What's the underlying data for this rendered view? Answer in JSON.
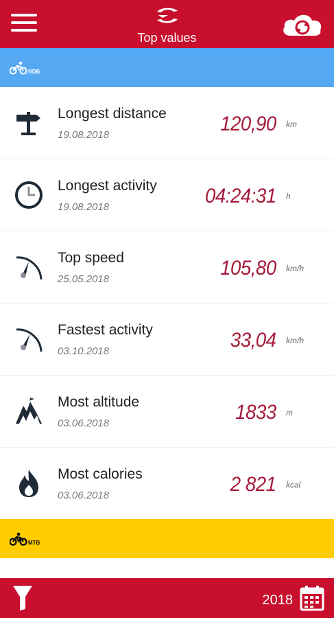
{
  "header": {
    "title": "Top values",
    "menu_icon": "hamburger-menu-icon",
    "logo_icon": "app-logo-icon",
    "sync_icon": "cloud-sync-icon"
  },
  "colors": {
    "primary": "#c8102e",
    "road_category": "#55a8f2",
    "mtb_category": "#ffcc00",
    "value": "#a6193a"
  },
  "categories": {
    "road": {
      "label": "RDB",
      "icon": "road-bike-icon"
    },
    "mtb": {
      "label": "MTB",
      "icon": "mountain-bike-icon"
    }
  },
  "records": [
    {
      "icon": "signpost-icon",
      "title": "Longest distance",
      "date": "19.08.2018",
      "value": "120,90",
      "unit": "km"
    },
    {
      "icon": "clock-icon",
      "title": "Longest activity",
      "date": "19.08.2018",
      "value": "04:24:31",
      "unit": "h"
    },
    {
      "icon": "speedometer-icon",
      "title": "Top speed",
      "date": "25.05.2018",
      "value": "105,80",
      "unit": "km/h"
    },
    {
      "icon": "speedometer-icon",
      "title": "Fastest activity",
      "date": "03.10.2018",
      "value": "33,04",
      "unit": "km/h"
    },
    {
      "icon": "mountain-icon",
      "title": "Most altitude",
      "date": "03.06.2018",
      "value": "1833",
      "unit": "m"
    },
    {
      "icon": "flame-icon",
      "title": "Most calories",
      "date": "03.06.2018",
      "value": "2 821",
      "unit": "kcal"
    }
  ],
  "footer": {
    "filter_icon": "filter-icon",
    "year": "2018",
    "calendar_icon": "calendar-icon"
  }
}
